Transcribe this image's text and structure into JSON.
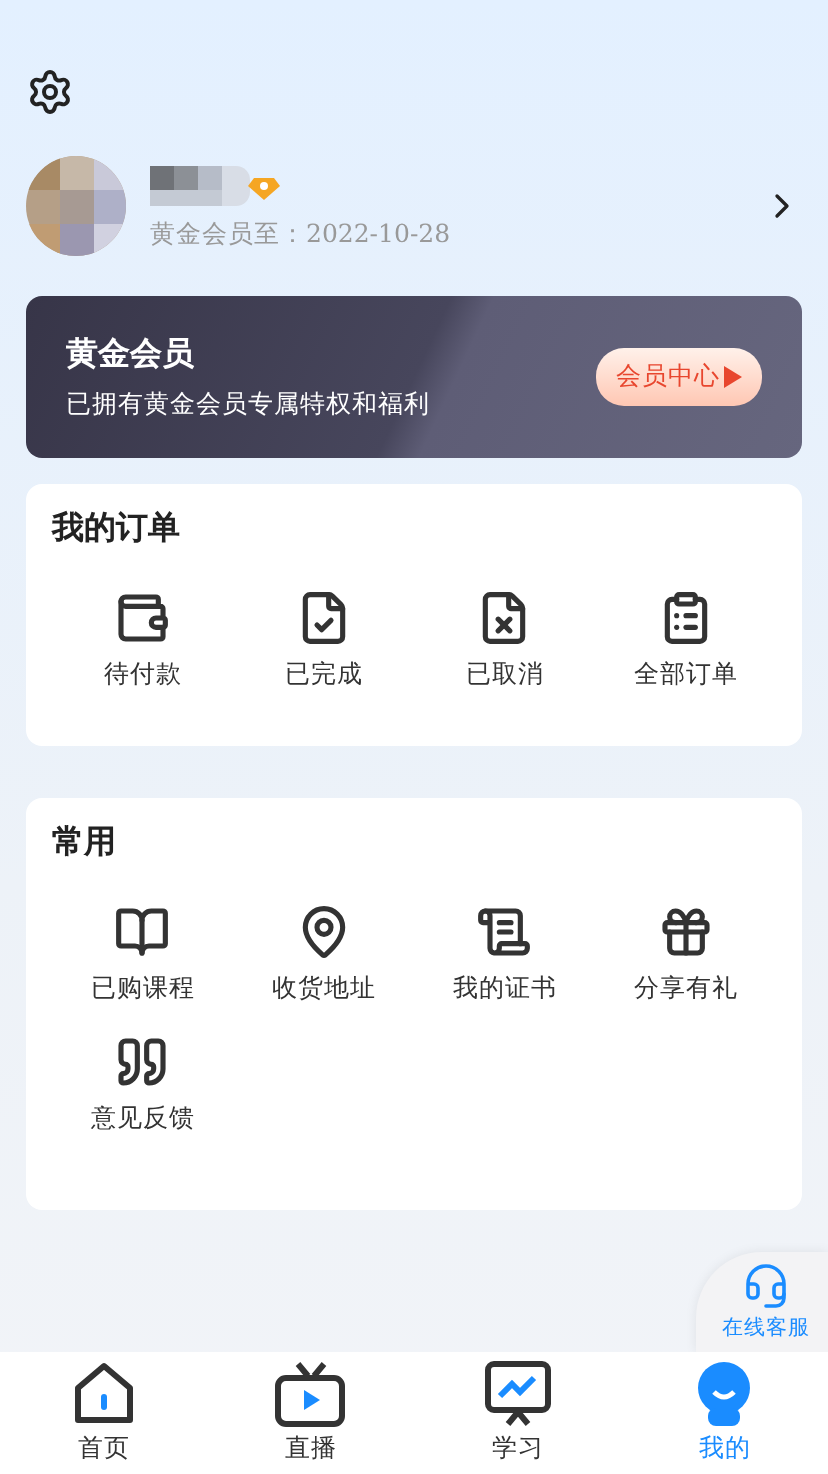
{
  "profile": {
    "member_until": "黄金会员至：2022-10-28"
  },
  "banner": {
    "title": "黄金会员",
    "subtitle": "已拥有黄金会员专属特权和福利",
    "button": "会员中心"
  },
  "orders": {
    "title": "我的订单",
    "items": [
      {
        "kind": "wallet",
        "label": "待付款"
      },
      {
        "kind": "done",
        "label": "已完成"
      },
      {
        "kind": "cancel",
        "label": "已取消"
      },
      {
        "kind": "all",
        "label": "全部订单"
      }
    ]
  },
  "common": {
    "title": "常用",
    "items": [
      {
        "kind": "book",
        "label": "已购课程"
      },
      {
        "kind": "pin",
        "label": "收货地址"
      },
      {
        "kind": "scroll",
        "label": "我的证书"
      },
      {
        "kind": "gift",
        "label": "分享有礼"
      },
      {
        "kind": "quote",
        "label": "意见反馈"
      }
    ]
  },
  "service": {
    "label": "在线客服"
  },
  "tabs": [
    {
      "kind": "home",
      "label": "首页",
      "selected": false
    },
    {
      "kind": "live",
      "label": "直播",
      "selected": false
    },
    {
      "kind": "study",
      "label": "学习",
      "selected": false
    },
    {
      "kind": "me",
      "label": "我的",
      "selected": true
    }
  ]
}
